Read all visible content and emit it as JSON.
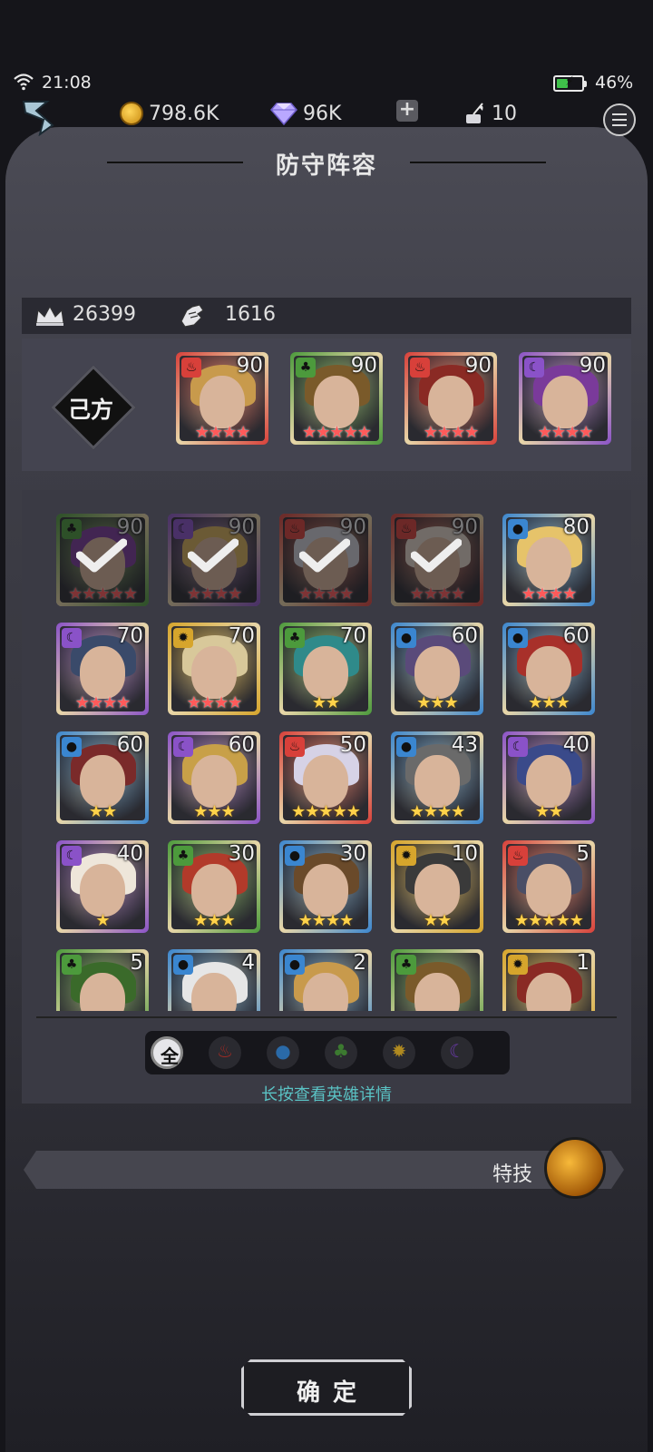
{
  "status": {
    "time": "21:08",
    "battery": "46%",
    "battery_level": 0.46
  },
  "resources": {
    "gold": "798.6K",
    "gems": "96K",
    "tickets": "10"
  },
  "title": "防守阵容",
  "stats": {
    "power": "26399",
    "wins": "1616"
  },
  "team": {
    "badge": "己方",
    "heroes": [
      {
        "level": "90",
        "element": "fire",
        "stars": 4,
        "star_color": "red"
      },
      {
        "level": "90",
        "element": "nature",
        "stars": 5,
        "star_color": "red"
      },
      {
        "level": "90",
        "element": "fire",
        "stars": 4,
        "star_color": "red"
      },
      {
        "level": "90",
        "element": "moon",
        "stars": 4,
        "star_color": "red"
      }
    ]
  },
  "roster": [
    {
      "level": "90",
      "element": "nature",
      "stars": 5,
      "star_color": "red",
      "selected": true
    },
    {
      "level": "90",
      "element": "moon",
      "stars": 4,
      "star_color": "red",
      "selected": true
    },
    {
      "level": "90",
      "element": "fire",
      "stars": 4,
      "star_color": "red",
      "selected": true
    },
    {
      "level": "90",
      "element": "fire",
      "stars": 4,
      "star_color": "red",
      "selected": true
    },
    {
      "level": "80",
      "element": "water",
      "stars": 4,
      "star_color": "red",
      "selected": false
    },
    {
      "level": "70",
      "element": "moon",
      "stars": 4,
      "star_color": "red",
      "selected": false
    },
    {
      "level": "70",
      "element": "sun",
      "stars": 4,
      "star_color": "red",
      "selected": false
    },
    {
      "level": "70",
      "element": "nature",
      "stars": 2,
      "star_color": "gold",
      "selected": false
    },
    {
      "level": "60",
      "element": "water",
      "stars": 3,
      "star_color": "gold",
      "selected": false
    },
    {
      "level": "60",
      "element": "water",
      "stars": 3,
      "star_color": "gold",
      "selected": false
    },
    {
      "level": "60",
      "element": "water",
      "stars": 2,
      "star_color": "gold",
      "selected": false
    },
    {
      "level": "60",
      "element": "moon",
      "stars": 3,
      "star_color": "gold",
      "selected": false
    },
    {
      "level": "50",
      "element": "fire",
      "stars": 5,
      "star_color": "gold",
      "selected": false
    },
    {
      "level": "43",
      "element": "water",
      "stars": 4,
      "star_color": "gold",
      "selected": false
    },
    {
      "level": "40",
      "element": "moon",
      "stars": 2,
      "star_color": "gold",
      "selected": false
    },
    {
      "level": "40",
      "element": "moon",
      "stars": 1,
      "star_color": "gold",
      "selected": false
    },
    {
      "level": "30",
      "element": "nature",
      "stars": 3,
      "star_color": "gold",
      "selected": false
    },
    {
      "level": "30",
      "element": "water",
      "stars": 4,
      "star_color": "gold",
      "selected": false
    },
    {
      "level": "10",
      "element": "sun",
      "stars": 2,
      "star_color": "gold",
      "selected": false
    },
    {
      "level": "5",
      "element": "fire",
      "stars": 5,
      "star_color": "gold",
      "selected": false
    },
    {
      "level": "5",
      "element": "nature",
      "stars": 0,
      "star_color": "gold",
      "selected": false
    },
    {
      "level": "4",
      "element": "water",
      "stars": 0,
      "star_color": "gold",
      "selected": false
    },
    {
      "level": "2",
      "element": "water",
      "stars": 0,
      "star_color": "gold",
      "selected": false
    },
    {
      "level": "",
      "element": "nature",
      "stars": 0,
      "star_color": "gold",
      "selected": false
    },
    {
      "level": "1",
      "element": "sun",
      "stars": 0,
      "star_color": "gold",
      "selected": false
    }
  ],
  "filters": {
    "all_label": "全"
  },
  "hint": "长按查看英雄详情",
  "skill_label": "特技",
  "confirm_label": "确定",
  "colors": {
    "fire": "#d8403a",
    "nature": "#4c9a3c",
    "water": "#3a86d0",
    "moon": "#8a52c8",
    "sun": "#d6a52c",
    "hint": "#5ac2c4"
  }
}
